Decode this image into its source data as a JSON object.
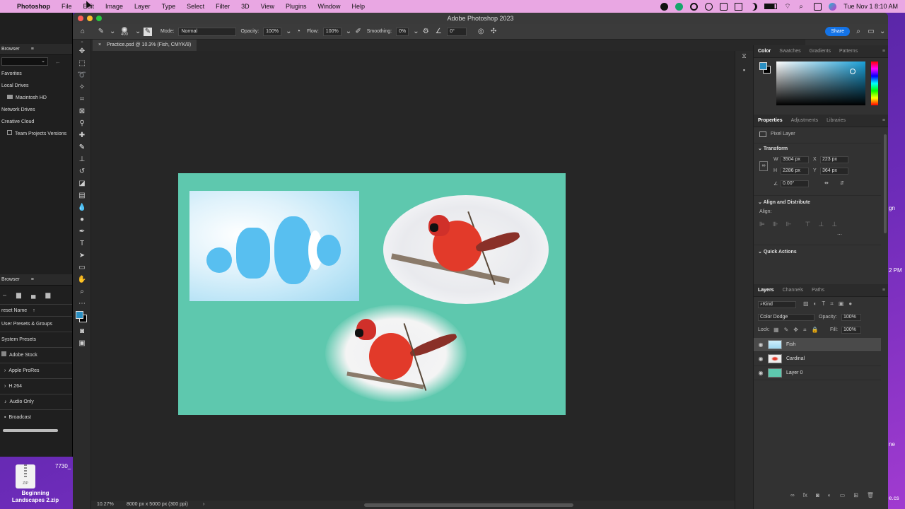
{
  "menubar": {
    "apple": "",
    "app_name": "Photoshop",
    "items": [
      "File",
      "Edit",
      "Image",
      "Layer",
      "Type",
      "Select",
      "Filter",
      "3D",
      "View",
      "Plugins",
      "Window",
      "Help"
    ],
    "clock": "Tue Nov 1  8:10 AM"
  },
  "window": {
    "title": "Adobe Photoshop 2023"
  },
  "options": {
    "brush_size": "400",
    "mode_label": "Mode:",
    "mode_value": "Normal",
    "opacity_label": "Opacity:",
    "opacity_value": "100%",
    "flow_label": "Flow:",
    "flow_value": "100%",
    "smoothing_label": "Smoothing:",
    "smoothing_value": "0%",
    "angle_value": "0°",
    "share_label": "Share"
  },
  "document": {
    "tab_label": "Practice.psd @ 10.3% (Fish, CMYK/8)",
    "zoom": "10.27%",
    "size_info": "8000 px x 5000 px (300 ppi)"
  },
  "left_panel": {
    "browser_title": "Browser",
    "favorites": "Favorites",
    "local_drives": "Local Drives",
    "macintosh_hd": "Macintosh HD",
    "network_drives": "Network Drives",
    "creative_cloud": "Creative Cloud",
    "team_projects": "Team Projects Versions",
    "browser2_title": "Browser",
    "preset_name": "reset Name",
    "user_presets": "User Presets & Groups",
    "system_presets": "System Presets",
    "adobe_stock": "Adobe Stock",
    "apple_prores": "Apple ProRes",
    "h264": "H.264",
    "audio_only": "Audio Only",
    "broadcast": "Broadcast"
  },
  "color_panel": {
    "tabs": [
      "Color",
      "Swatches",
      "Gradients",
      "Patterns"
    ],
    "foreground": "#2a8fc2",
    "background": "#000000"
  },
  "properties_panel": {
    "tabs": [
      "Properties",
      "Adjustments",
      "Libraries"
    ],
    "layer_type": "Pixel Layer",
    "transform_title": "Transform",
    "w_label": "W",
    "w_value": "3504 px",
    "h_label": "H",
    "h_value": "2286 px",
    "x_label": "X",
    "x_value": "223 px",
    "y_label": "Y",
    "y_value": "364 px",
    "angle_value": "0.00°",
    "align_title": "Align and Distribute",
    "align_label": "Align:",
    "quick_actions": "Quick Actions"
  },
  "layers_panel": {
    "tabs": [
      "Layers",
      "Channels",
      "Paths"
    ],
    "filter_kind": "Kind",
    "blend_mode": "Color Dodge",
    "opacity_label": "Opacity:",
    "opacity_value": "100%",
    "lock_label": "Lock:",
    "fill_label": "Fill:",
    "fill_value": "100%",
    "layers": [
      {
        "name": "Fish",
        "selected": true
      },
      {
        "name": "Cardinal",
        "selected": false
      },
      {
        "name": "Layer 0",
        "selected": false
      }
    ]
  },
  "desktop": {
    "zip_label": "ZIP",
    "file_label_line1": "Beginning",
    "file_label_line2": "Landscapes 2.zip",
    "partial_text": "7730_",
    "right_edge_1": "gn",
    "right_edge_2": "2 PM",
    "right_edge_3": "ne",
    "right_edge_4": "e.cs"
  },
  "colors": {
    "canvas_bg": "#5ec8ae",
    "accent": "#1473e6"
  }
}
